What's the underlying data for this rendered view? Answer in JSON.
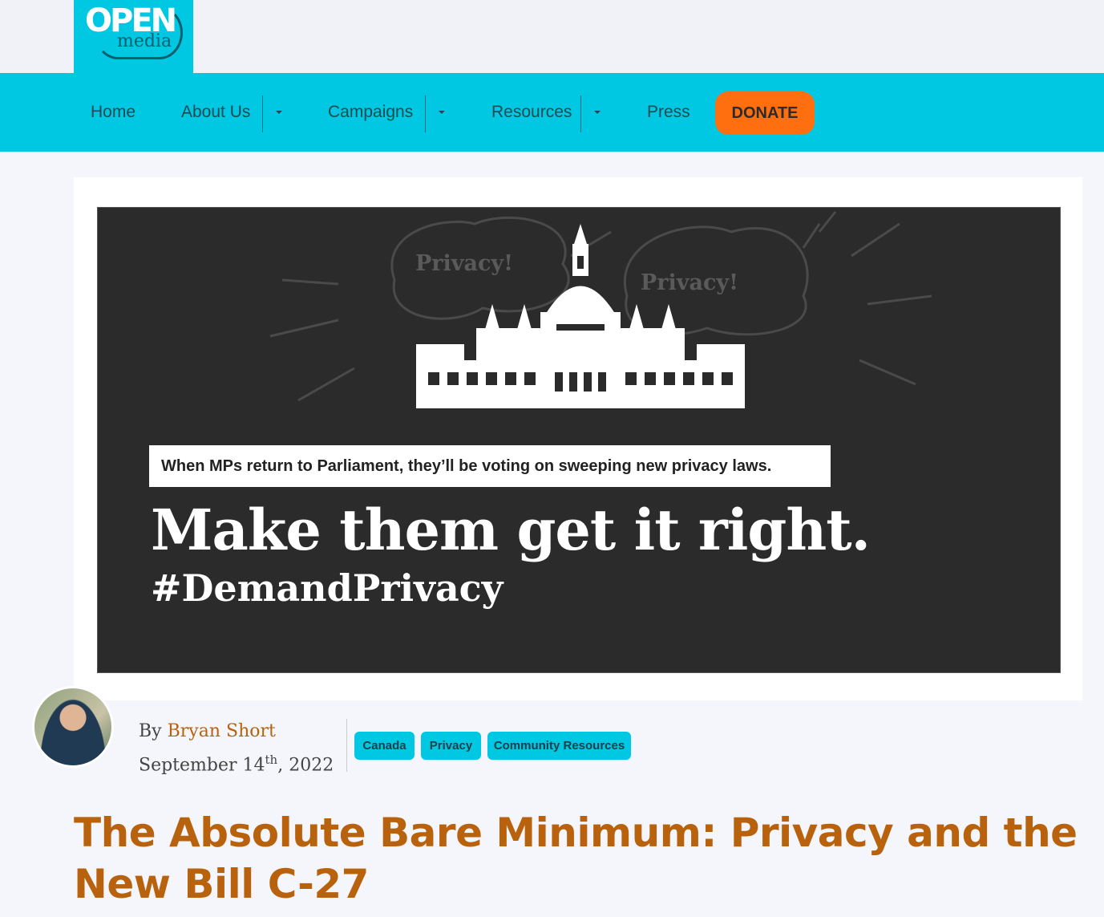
{
  "site": {
    "logo_line1": "OPEN",
    "logo_line2": "media"
  },
  "nav": {
    "items": [
      "Home",
      "About Us",
      "Campaigns",
      "Resources",
      "Press"
    ],
    "donate_label": "DONATE"
  },
  "hero": {
    "cloud_text_1": "Privacy!",
    "cloud_text_2": "Privacy!",
    "subheading": "When MPs return to Parliament, they’ll be voting on sweeping new privacy laws.",
    "headline": "Make them get it right.",
    "hashtag": "#DemandPrivacy"
  },
  "meta": {
    "by_label": "By",
    "author": "Bryan Short",
    "date_day": "September 14",
    "date_suffix": "th",
    "date_year": ", 2022",
    "tags": [
      "Canada",
      "Privacy",
      "Community Resources"
    ]
  },
  "article": {
    "title": "The Absolute Bare Minimum: Privacy and the New Bill C-27"
  },
  "colors": {
    "brand_cyan": "#00c7e2",
    "donate_orange": "#ff6f0f",
    "title_orange": "#b8620e",
    "hero_bg": "#2b2b2b"
  }
}
